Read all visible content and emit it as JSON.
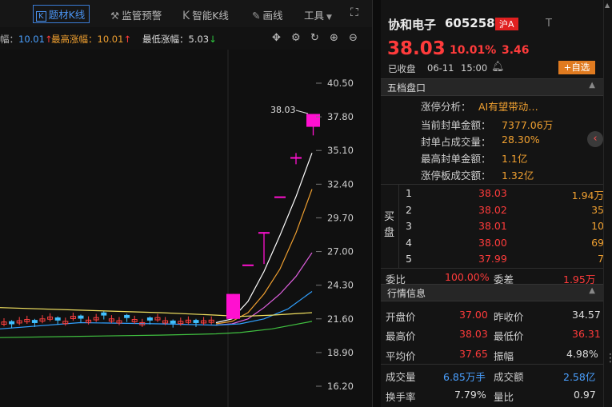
{
  "toolbar": {
    "topic_k": "题材K线",
    "monitor": "监管预警",
    "smart_k": "智能K线",
    "draw": "画线",
    "tools": "工具"
  },
  "stats": {
    "first_val": "10.01",
    "highest_label": "最高涨幅：",
    "highest_val": "10.01",
    "lowest_label": "最低涨幅：",
    "lowest_val": "5.03"
  },
  "chart_data": {
    "type": "candlestick",
    "y_ticks": [
      "40.50",
      "37.80",
      "35.10",
      "32.40",
      "29.70",
      "27.00",
      "24.30",
      "21.60",
      "18.90",
      "16.20"
    ],
    "ylim": [
      16.2,
      40.5
    ],
    "last_label": "38.03",
    "candles_recent": [
      {
        "open": 21.6,
        "close": 23.6,
        "high": 23.6,
        "low": 21.6,
        "color": "#ff10d0"
      },
      {
        "open": 25.96,
        "close": 25.96,
        "high": 25.96,
        "low": 25.96,
        "color": "#ff10d0"
      },
      {
        "open": 28.56,
        "close": 28.56,
        "high": 28.56,
        "low": 26.0,
        "color": "#ff10d0"
      },
      {
        "open": 31.42,
        "close": 31.42,
        "high": 31.42,
        "low": 31.42,
        "color": "#ff10d0"
      },
      {
        "open": 34.57,
        "close": 34.57,
        "high": 34.9,
        "low": 34.0,
        "color": "#ff10d0"
      },
      {
        "open": 37.0,
        "close": 38.03,
        "high": 38.03,
        "low": 36.31,
        "color": "#ff10d0"
      }
    ],
    "ma_lines": [
      {
        "color": "#ffffff",
        "points": [
          [
            270,
            21.3
          ],
          [
            290,
            21.6
          ],
          [
            310,
            23.0
          ],
          [
            330,
            25.4
          ],
          [
            350,
            28.3
          ],
          [
            370,
            31.4
          ],
          [
            390,
            34.9
          ]
        ]
      },
      {
        "color": "#f0a030",
        "points": [
          [
            270,
            21.2
          ],
          [
            290,
            21.4
          ],
          [
            310,
            22.1
          ],
          [
            330,
            23.6
          ],
          [
            350,
            25.6
          ],
          [
            370,
            28.5
          ],
          [
            390,
            32.0
          ]
        ]
      },
      {
        "color": "#e060e0",
        "points": [
          [
            270,
            21.1
          ],
          [
            290,
            21.2
          ],
          [
            310,
            21.6
          ],
          [
            330,
            22.5
          ],
          [
            350,
            23.6
          ],
          [
            370,
            25.0
          ],
          [
            390,
            26.9
          ]
        ]
      },
      {
        "color": "#30a0ff",
        "points": [
          [
            0,
            20.8
          ],
          [
            100,
            21.3
          ],
          [
            200,
            21.2
          ],
          [
            270,
            21.1
          ],
          [
            300,
            21.2
          ],
          [
            330,
            21.6
          ],
          [
            360,
            22.4
          ],
          [
            390,
            23.8
          ]
        ]
      },
      {
        "color": "#f0e060",
        "points": [
          [
            0,
            22.5
          ],
          [
            100,
            22.3
          ],
          [
            200,
            22.1
          ],
          [
            270,
            21.9
          ],
          [
            300,
            21.8
          ],
          [
            340,
            21.9
          ],
          [
            390,
            22.1
          ]
        ]
      },
      {
        "color": "#40c040",
        "points": [
          [
            0,
            20.1
          ],
          [
            100,
            20.2
          ],
          [
            200,
            20.3
          ],
          [
            270,
            20.4
          ],
          [
            300,
            20.5
          ],
          [
            340,
            20.8
          ],
          [
            390,
            21.4
          ]
        ]
      }
    ]
  },
  "stock": {
    "name": "协和电子",
    "code": "605258",
    "market": "沪A",
    "t": "T",
    "price": "38.03",
    "pct": "10.01%",
    "change": "3.46",
    "status": "已收盘",
    "date": "06-11",
    "time": "15:00",
    "watch": "自选"
  },
  "panel": {
    "title": "五档盘口",
    "rows": [
      {
        "label": "涨停分析：",
        "value": "AI有望带动…"
      },
      {
        "label": "当前封单金额：",
        "value": "7377.06万"
      },
      {
        "label": "封单占成交量：",
        "value": "28.30%"
      },
      {
        "label": "最高封单金额：",
        "value": "1.1亿"
      },
      {
        "label": "涨停板成交额：",
        "value": "1.32亿"
      }
    ],
    "buy_label": "买盘",
    "buy": [
      {
        "level": "1",
        "price": "38.03",
        "vol": "1.94万"
      },
      {
        "level": "2",
        "price": "38.02",
        "vol": "35"
      },
      {
        "level": "3",
        "price": "38.01",
        "vol": "10"
      },
      {
        "level": "4",
        "price": "38.00",
        "vol": "69"
      },
      {
        "level": "5",
        "price": "37.99",
        "vol": "7"
      }
    ],
    "weibi_label": "委比",
    "weibi": "100.00%",
    "weicha_label": "委差",
    "weicha": "1.95万"
  },
  "market": {
    "title": "行情信息",
    "rows": [
      [
        {
          "label": "开盘价",
          "value": "37.00"
        },
        {
          "label": "昨收价",
          "value": "34.57"
        }
      ],
      [
        {
          "label": "最高价",
          "value": "38.03"
        },
        {
          "label": "最低价",
          "value": "36.31"
        }
      ],
      [
        {
          "label": "平均价",
          "value": "37.65"
        },
        {
          "label": "振幅",
          "value": "4.98%"
        }
      ],
      [
        {
          "label": "成交量",
          "value": "6.85万手"
        },
        {
          "label": "成交额",
          "value": "2.58亿"
        }
      ],
      [
        {
          "label": "换手率",
          "value": "7.79%"
        },
        {
          "label": "量比",
          "value": "0.97"
        }
      ]
    ]
  }
}
